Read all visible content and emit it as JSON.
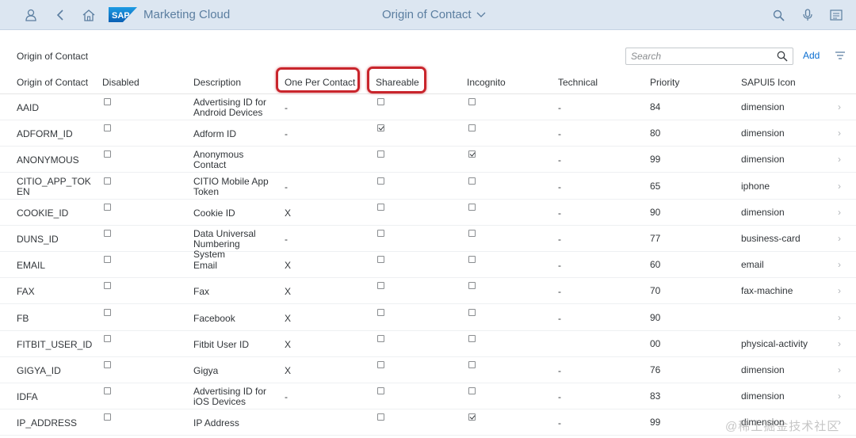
{
  "shell": {
    "app_title": "Marketing Cloud",
    "page_context": "Origin of Contact",
    "logo_text": "SAP"
  },
  "toolbar": {
    "title": "Origin of Contact",
    "search_placeholder": "Search",
    "add_label": "Add"
  },
  "columns": [
    "Origin of Contact",
    "Disabled",
    "Description",
    "One Per Contact",
    "Shareable",
    "Incognito",
    "Technical",
    "Priority",
    "SAPUI5 Icon"
  ],
  "rows": [
    {
      "origin": "AAID",
      "disabled": false,
      "desc": "Advertising ID for Android Devices",
      "one": "-",
      "share": false,
      "incog": false,
      "tech": "-",
      "prio": "84",
      "icon": "dimension"
    },
    {
      "origin": "ADFORM_ID",
      "disabled": false,
      "desc": "Adform ID",
      "one": "-",
      "share": true,
      "incog": false,
      "tech": "-",
      "prio": "80",
      "icon": "dimension"
    },
    {
      "origin": "ANONYMOUS",
      "disabled": false,
      "desc": "Anonymous Contact",
      "one": "",
      "share": false,
      "incog": true,
      "tech": "-",
      "prio": "99",
      "icon": "dimension"
    },
    {
      "origin": "CITIO_APP_TOKEN",
      "disabled": false,
      "desc": "CITIO Mobile App Token",
      "one": "-",
      "share": false,
      "incog": false,
      "tech": "-",
      "prio": "65",
      "icon": "iphone"
    },
    {
      "origin": "COOKIE_ID",
      "disabled": false,
      "desc": "Cookie ID",
      "one": "X",
      "share": false,
      "incog": false,
      "tech": "-",
      "prio": "90",
      "icon": "dimension"
    },
    {
      "origin": "DUNS_ID",
      "disabled": false,
      "desc": "Data Universal Numbering System",
      "one": "-",
      "share": false,
      "incog": false,
      "tech": "-",
      "prio": "77",
      "icon": "business-card"
    },
    {
      "origin": "EMAIL",
      "disabled": false,
      "desc": "Email",
      "one": "X",
      "share": false,
      "incog": false,
      "tech": "-",
      "prio": "60",
      "icon": "email"
    },
    {
      "origin": "FAX",
      "disabled": false,
      "desc": "Fax",
      "one": "X",
      "share": false,
      "incog": false,
      "tech": "-",
      "prio": "70",
      "icon": "fax-machine"
    },
    {
      "origin": "FB",
      "disabled": false,
      "desc": "Facebook",
      "one": "X",
      "share": false,
      "incog": false,
      "tech": "-",
      "prio": "90",
      "icon": ""
    },
    {
      "origin": "FITBIT_USER_ID",
      "disabled": false,
      "desc": "Fitbit User ID",
      "one": "X",
      "share": false,
      "incog": false,
      "tech": "",
      "prio": "00",
      "icon": "physical-activity"
    },
    {
      "origin": "GIGYA_ID",
      "disabled": false,
      "desc": "Gigya",
      "one": "X",
      "share": false,
      "incog": false,
      "tech": "-",
      "prio": "76",
      "icon": "dimension"
    },
    {
      "origin": "IDFA",
      "disabled": false,
      "desc": "Advertising ID for iOS Devices",
      "one": "-",
      "share": false,
      "incog": false,
      "tech": "-",
      "prio": "83",
      "icon": "dimension"
    },
    {
      "origin": "IP_ADDRESS",
      "disabled": false,
      "desc": "IP Address",
      "one": "",
      "share": false,
      "incog": true,
      "tech": "-",
      "prio": "99",
      "icon": "dimension"
    }
  ],
  "watermark": "@稀土掘金技术社区",
  "colors": {
    "shell_bg": "#dce6f1",
    "highlight": "#c9252c",
    "link": "#0a6ed1"
  }
}
